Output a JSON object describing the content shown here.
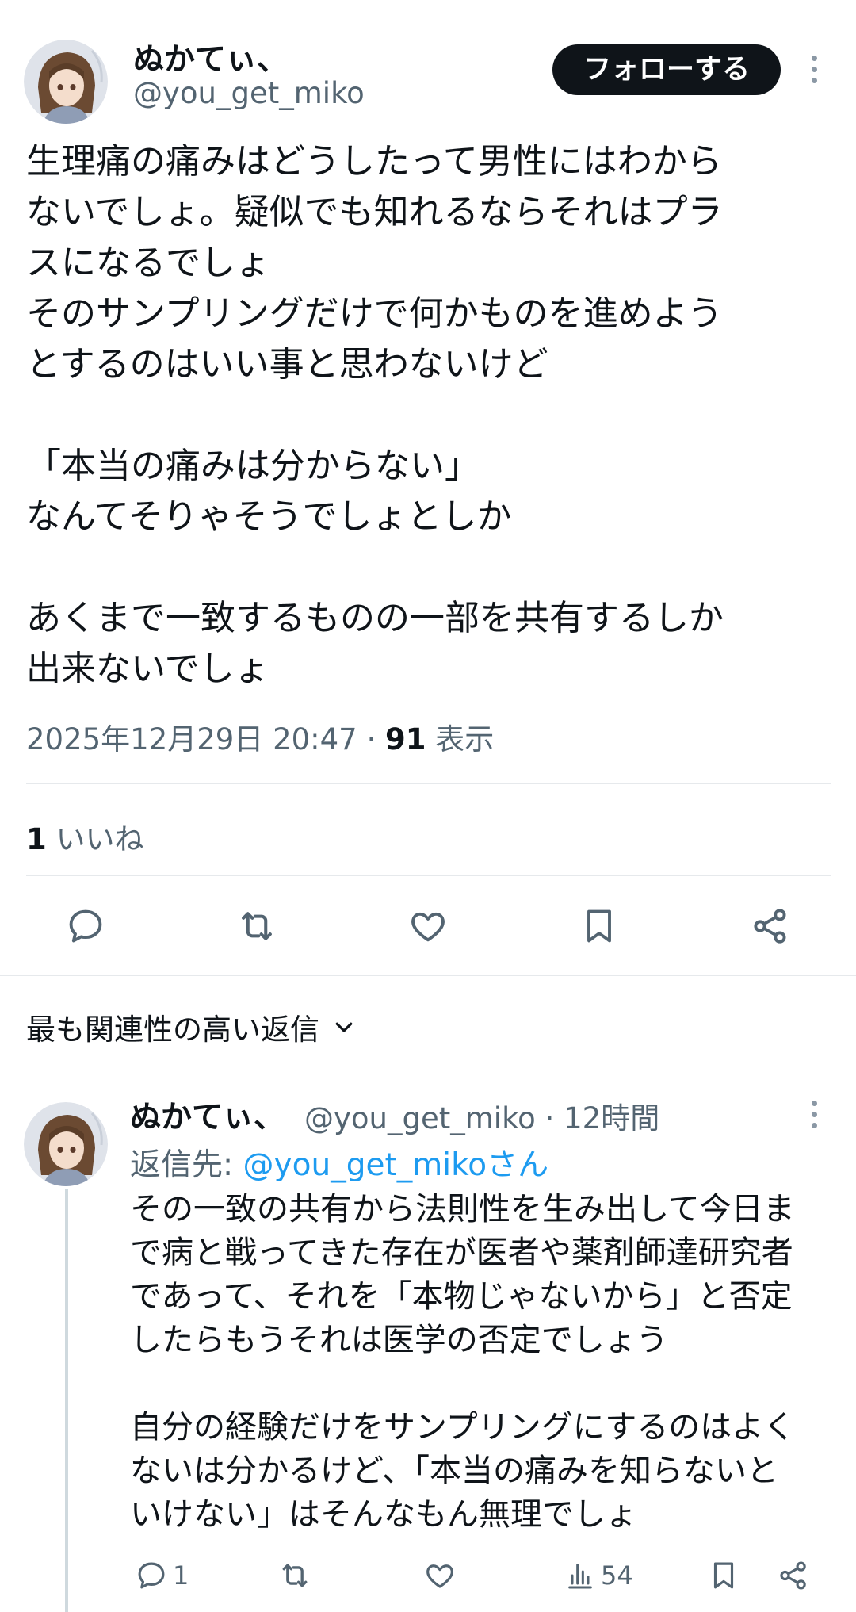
{
  "tweet": {
    "author_name": "ぬかてぃ、",
    "author_handle": "@you_get_miko",
    "follow_label": "フォローする",
    "text": "生理痛の痛みはどうしたって男性にはわから\nないでしょ。疑似でも知れるならそれはプラ\nスになるでしょ\nそのサンプリングだけで何かものを進めよう\nとするのはいい事と思わないけど\n\n「本当の痛みは分からない」\nなんてそりゃそうでしょとしか\n\nあくまで一致するものの一部を共有するしか\n出来ないでしょ",
    "timestamp": "2025年12月29日 20:47",
    "separator": "·",
    "views_count": "91",
    "views_label": "表示",
    "likes_count": "1",
    "likes_label": "いいね"
  },
  "actions": {
    "reply": "reply-icon",
    "retweet": "retweet-icon",
    "like": "heart-icon",
    "bookmark": "bookmark-icon",
    "share": "share-icon"
  },
  "replies_section": {
    "sort_label": "最も関連性の高い返信"
  },
  "reply": {
    "author_name": "ぬかてぃ、",
    "author_handle": "@you_get_miko",
    "time": "12時間",
    "separator": "·",
    "reply_to_label": "返信先:",
    "reply_to_handle": "@you_get_mikoさん",
    "text": "その一致の共有から法則性を生み出して今日ま\nで病と戦ってきた存在が医者や薬剤師達研究者\nであって、それを「本物じゃないから」と否定\nしたらもうそれは医学の否定でしょう\n\n自分の経験だけをサンプリングにするのはよく\nないは分かるけど、「本当の痛みを知らないと\nいけない」はそんなもん無理でしょ",
    "reply_count": "1",
    "views_count": "54"
  },
  "colors": {
    "text": "#0f1419",
    "secondary": "#536471",
    "link": "#1d9bf0",
    "divider": "#e6e9ec"
  }
}
